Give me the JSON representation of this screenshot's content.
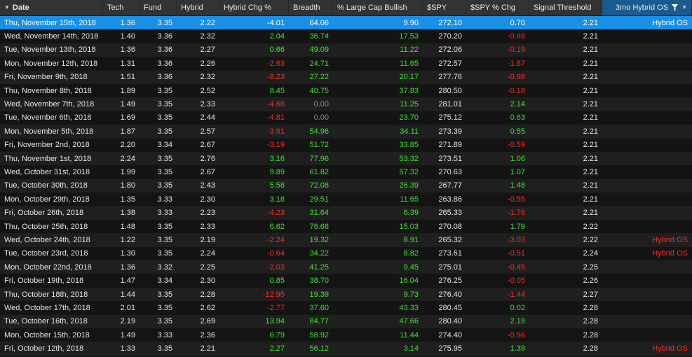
{
  "columns": {
    "date": "Date",
    "tech": "Tech",
    "fund": "Fund",
    "hybrid": "Hybrid",
    "hybrid_chg": "Hybrid Chg %",
    "breadth": "Breadth",
    "large_cap": "% Large Cap Bullish",
    "spy": "$SPY",
    "spy_chg": "$SPY % Chg",
    "signal": "Signal Threshold",
    "os": "3mo Hybrid OS"
  },
  "colors": {
    "positive": "#3ee62e",
    "negative": "#ff2a1f",
    "selected": "#1a8fe6"
  },
  "icons": {
    "date_sort": "sort-triangle-icon",
    "os_filter": "filter-icon",
    "os_menu": "chevron-down-icon"
  },
  "rows": [
    {
      "date": "Thu, November 15th, 2018",
      "tech": "1.36",
      "fund": "3.35",
      "hybrid": "2.22",
      "chg": "-4.01",
      "breadth": "64.06",
      "lc": "9.90",
      "spy": "272.10",
      "spychg": "0.70",
      "signal": "2.21",
      "os": "Hybrid OS",
      "selected": true
    },
    {
      "date": "Wed, November 14th, 2018",
      "tech": "1.40",
      "fund": "3.36",
      "hybrid": "2.32",
      "chg": "2.04",
      "breadth": "36.74",
      "lc": "17.53",
      "spy": "270.20",
      "spychg": "-0.68",
      "signal": "2.21",
      "os": ""
    },
    {
      "date": "Tue, November 13th, 2018",
      "tech": "1.36",
      "fund": "3.36",
      "hybrid": "2.27",
      "chg": "0.66",
      "breadth": "49.09",
      "lc": "11.22",
      "spy": "272.06",
      "spychg": "-0.19",
      "signal": "2.21",
      "os": ""
    },
    {
      "date": "Mon, November 12th, 2018",
      "tech": "1.31",
      "fund": "3.36",
      "hybrid": "2.26",
      "chg": "-2.63",
      "breadth": "24.71",
      "lc": "11.65",
      "spy": "272.57",
      "spychg": "-1.87",
      "signal": "2.21",
      "os": ""
    },
    {
      "date": "Fri, November 9th, 2018",
      "tech": "1.51",
      "fund": "3.36",
      "hybrid": "2.32",
      "chg": "-8.23",
      "breadth": "27.22",
      "lc": "20.17",
      "spy": "277.76",
      "spychg": "-0.98",
      "signal": "2.21",
      "os": ""
    },
    {
      "date": "Thu, November 8th, 2018",
      "tech": "1.89",
      "fund": "3.35",
      "hybrid": "2.52",
      "chg": "8.45",
      "breadth": "40.75",
      "lc": "37.83",
      "spy": "280.50",
      "spychg": "-0.18",
      "signal": "2.21",
      "os": ""
    },
    {
      "date": "Wed, November 7th, 2018",
      "tech": "1.49",
      "fund": "3.35",
      "hybrid": "2.33",
      "chg": "-4.68",
      "breadth": "0.00",
      "lc": "11.25",
      "spy": "281.01",
      "spychg": "2.14",
      "signal": "2.21",
      "os": ""
    },
    {
      "date": "Tue, November 6th, 2018",
      "tech": "1.69",
      "fund": "3.35",
      "hybrid": "2.44",
      "chg": "-4.81",
      "breadth": "0.00",
      "lc": "23.70",
      "spy": "275.12",
      "spychg": "0.63",
      "signal": "2.21",
      "os": ""
    },
    {
      "date": "Mon, November 5th, 2018",
      "tech": "1.87",
      "fund": "3.35",
      "hybrid": "2.57",
      "chg": "-3.91",
      "breadth": "54.96",
      "lc": "34.11",
      "spy": "273.39",
      "spychg": "0.55",
      "signal": "2.21",
      "os": ""
    },
    {
      "date": "Fri, November 2nd, 2018",
      "tech": "2.20",
      "fund": "3.34",
      "hybrid": "2.67",
      "chg": "-3.19",
      "breadth": "51.72",
      "lc": "33.85",
      "spy": "271.89",
      "spychg": "-0.59",
      "signal": "2.21",
      "os": ""
    },
    {
      "date": "Thu, November 1st, 2018",
      "tech": "2.24",
      "fund": "3.35",
      "hybrid": "2.76",
      "chg": "3.16",
      "breadth": "77.96",
      "lc": "53.32",
      "spy": "273.51",
      "spychg": "1.06",
      "signal": "2.21",
      "os": ""
    },
    {
      "date": "Wed, October 31st, 2018",
      "tech": "1.99",
      "fund": "3.35",
      "hybrid": "2.67",
      "chg": "9.89",
      "breadth": "61.82",
      "lc": "57.32",
      "spy": "270.63",
      "spychg": "1.07",
      "signal": "2.21",
      "os": ""
    },
    {
      "date": "Tue, October 30th, 2018",
      "tech": "1.80",
      "fund": "3.35",
      "hybrid": "2.43",
      "chg": "5.58",
      "breadth": "72.08",
      "lc": "26.39",
      "spy": "267.77",
      "spychg": "1.48",
      "signal": "2.21",
      "os": ""
    },
    {
      "date": "Mon, October 29th, 2018",
      "tech": "1.35",
      "fund": "3.33",
      "hybrid": "2.30",
      "chg": "3.18",
      "breadth": "29.51",
      "lc": "11.65",
      "spy": "263.86",
      "spychg": "-0.55",
      "signal": "2.21",
      "os": ""
    },
    {
      "date": "Fri, October 26th, 2018",
      "tech": "1.38",
      "fund": "3.33",
      "hybrid": "2.23",
      "chg": "-4.23",
      "breadth": "31.64",
      "lc": "6.39",
      "spy": "265.33",
      "spychg": "-1.76",
      "signal": "2.21",
      "os": ""
    },
    {
      "date": "Thu, October 25th, 2018",
      "tech": "1.48",
      "fund": "3.35",
      "hybrid": "2.33",
      "chg": "6.62",
      "breadth": "76.68",
      "lc": "15.03",
      "spy": "270.08",
      "spychg": "1.79",
      "signal": "2.22",
      "os": ""
    },
    {
      "date": "Wed, October 24th, 2018",
      "tech": "1.22",
      "fund": "3.35",
      "hybrid": "2.19",
      "chg": "-2.24",
      "breadth": "19.32",
      "lc": "8.91",
      "spy": "265.32",
      "spychg": "-3.03",
      "signal": "2.22",
      "os": "Hybrid OS"
    },
    {
      "date": "Tue, October 23rd, 2018",
      "tech": "1.30",
      "fund": "3.35",
      "hybrid": "2.24",
      "chg": "-0.64",
      "breadth": "34.22",
      "lc": "8.82",
      "spy": "273.61",
      "spychg": "-0.51",
      "signal": "2.24",
      "os": "Hybrid OS"
    },
    {
      "date": "Mon, October 22nd, 2018",
      "tech": "1.36",
      "fund": "3.32",
      "hybrid": "2.25",
      "chg": "-2.03",
      "breadth": "41.25",
      "lc": "9.45",
      "spy": "275.01",
      "spychg": "-0.45",
      "signal": "2.25",
      "os": ""
    },
    {
      "date": "Fri, October 19th, 2018",
      "tech": "1.47",
      "fund": "3.34",
      "hybrid": "2.30",
      "chg": "0.85",
      "breadth": "38.70",
      "lc": "16.04",
      "spy": "276.25",
      "spychg": "-0.05",
      "signal": "2.26",
      "os": ""
    },
    {
      "date": "Thu, October 18th, 2018",
      "tech": "1.44",
      "fund": "3.35",
      "hybrid": "2.28",
      "chg": "-12.95",
      "breadth": "19.39",
      "lc": "9.73",
      "spy": "276.40",
      "spychg": "-1.44",
      "signal": "2.27",
      "os": ""
    },
    {
      "date": "Wed, October 17th, 2018",
      "tech": "2.01",
      "fund": "3.35",
      "hybrid": "2.62",
      "chg": "-2.77",
      "breadth": "37.60",
      "lc": "43.33",
      "spy": "280.45",
      "spychg": "0.02",
      "signal": "2.28",
      "os": ""
    },
    {
      "date": "Tue, October 16th, 2018",
      "tech": "2.19",
      "fund": "3.35",
      "hybrid": "2.69",
      "chg": "13.94",
      "breadth": "84.77",
      "lc": "47.66",
      "spy": "280.40",
      "spychg": "2.19",
      "signal": "2.28",
      "os": ""
    },
    {
      "date": "Mon, October 15th, 2018",
      "tech": "1.49",
      "fund": "3.33",
      "hybrid": "2.36",
      "chg": "6.79",
      "breadth": "58.92",
      "lc": "11.44",
      "spy": "274.40",
      "spychg": "-0.56",
      "signal": "2.28",
      "os": ""
    },
    {
      "date": "Fri, October 12th, 2018",
      "tech": "1.33",
      "fund": "3.35",
      "hybrid": "2.21",
      "chg": "2.27",
      "breadth": "56.12",
      "lc": "3.14",
      "spy": "275.95",
      "spychg": "1.39",
      "signal": "2.28",
      "os": "Hybrid OS"
    }
  ]
}
